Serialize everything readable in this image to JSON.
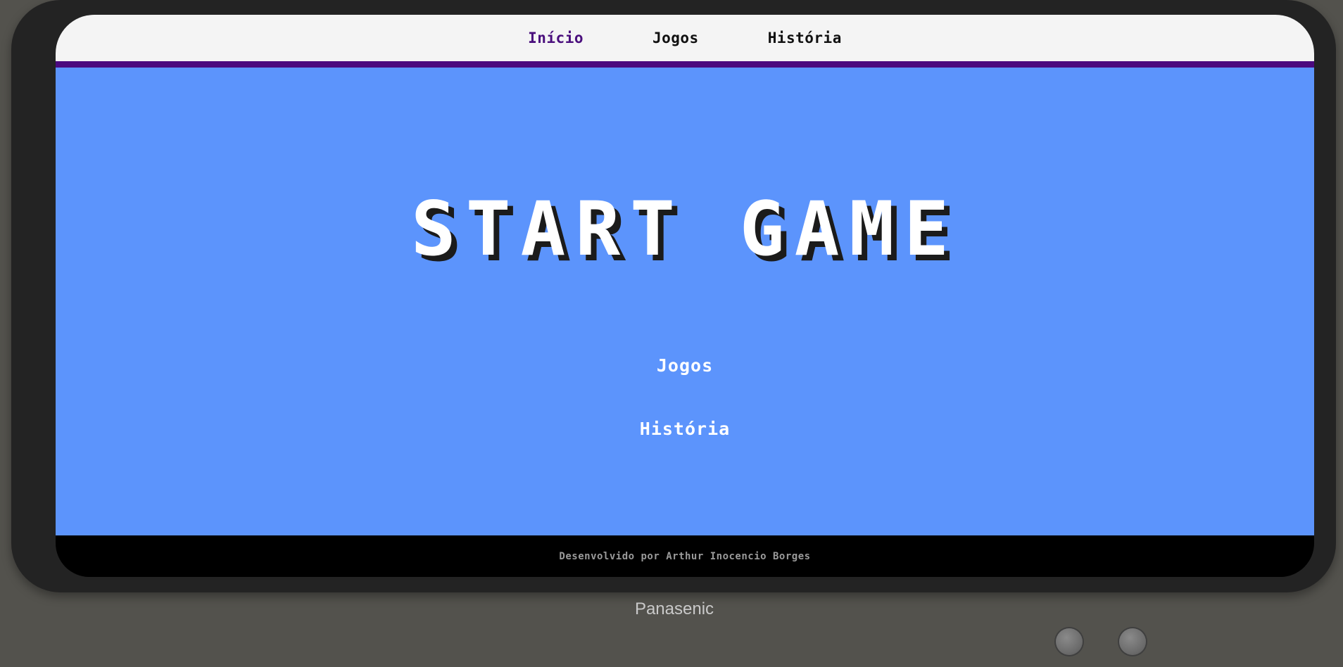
{
  "nav": {
    "items": [
      {
        "label": "Início",
        "active": true
      },
      {
        "label": "Jogos",
        "active": false
      },
      {
        "label": "História",
        "active": false
      }
    ]
  },
  "hero": {
    "title": "START GAME"
  },
  "menu": {
    "jogos_label": "Jogos",
    "historia_label": "História"
  },
  "footer": {
    "credit": "Desenvolvido por Arthur Inocencio Borges"
  },
  "tv": {
    "brand": "Panasenic"
  },
  "colors": {
    "screen_bg": "#5c94fc",
    "nav_accent": "#4b0a7e",
    "active_link": "#4a0f7d",
    "tv_frame": "#232323",
    "background": "#53524d"
  }
}
